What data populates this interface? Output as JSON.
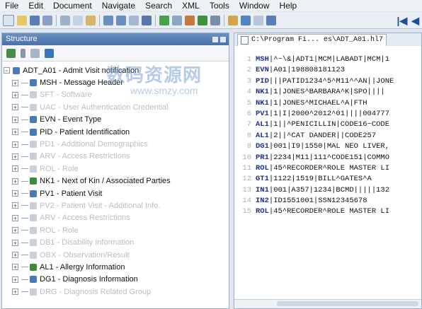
{
  "menu": [
    "File",
    "Edit",
    "Document",
    "Navigate",
    "Search",
    "XML",
    "Tools",
    "Window",
    "Help"
  ],
  "structure": {
    "title": "Structure",
    "rows": [
      {
        "code": "ADT_A01",
        "label": "ADT_A01 - Admit Visit notification",
        "dim": false,
        "root": true
      },
      {
        "code": "MSH",
        "label": "MSH - Message Header",
        "dim": false
      },
      {
        "code": "SFT",
        "label": "SFT - Software",
        "dim": true
      },
      {
        "code": "UAC",
        "label": "UAC - User Authentication Credential",
        "dim": true
      },
      {
        "code": "EVN",
        "label": "EVN - Event Type",
        "dim": false
      },
      {
        "code": "PID",
        "label": "PID - Patient Identification",
        "dim": false
      },
      {
        "code": "PD1",
        "label": "PD1 - Additional Demographics",
        "dim": true
      },
      {
        "code": "ARV",
        "label": "ARV - Access Restrictions",
        "dim": true
      },
      {
        "code": "ROL",
        "label": "ROL - Role",
        "dim": true
      },
      {
        "code": "NK1",
        "label": "NK1 - Next of Kin / Associated Parties",
        "dim": false,
        "group": true
      },
      {
        "code": "PV1",
        "label": "PV1 - Patient Visit",
        "dim": false
      },
      {
        "code": "PV2",
        "label": "PV2 - Patient Visit - Additional Info.",
        "dim": true
      },
      {
        "code": "ARV",
        "label": "ARV - Access Restrictions",
        "dim": true
      },
      {
        "code": "ROL",
        "label": "ROL - Role",
        "dim": true
      },
      {
        "code": "DB1",
        "label": "DB1 - Disability Information",
        "dim": true
      },
      {
        "code": "OBX",
        "label": "OBX - Observation/Result",
        "dim": true
      },
      {
        "code": "AL1",
        "label": "AL1 - Allergy Information",
        "dim": false,
        "group": true
      },
      {
        "code": "DG1",
        "label": "DG1 - Diagnosis Information",
        "dim": false
      },
      {
        "code": "DRG",
        "label": "DRG - Diagnosis Related Group",
        "dim": true
      }
    ]
  },
  "editor": {
    "tab": "C:\\Program Fi... es\\ADT_A01.hl7",
    "lines": [
      {
        "n": "1",
        "seg": "MSH",
        "rest": "|^~\\&|ADT1|MCM|LABADT|MCM|1"
      },
      {
        "n": "2",
        "seg": "EVN",
        "rest": "|A01|198808181123"
      },
      {
        "n": "3",
        "seg": "PID",
        "rest": "|||PATID1234^5^M11^^AN||JONE"
      },
      {
        "n": "4",
        "seg": "NK1",
        "rest": "|1|JONES^BARBARA^K|SPO||||"
      },
      {
        "n": "5",
        "seg": "NK1",
        "rest": "|1|JONES^MICHAEL^A|FTH"
      },
      {
        "n": "6",
        "seg": "PV1",
        "rest": "|1|I|2000^2012^01||||004777"
      },
      {
        "n": "7",
        "seg": "AL1",
        "rest": "|1||^PENICILLIN|CODE16~CODE"
      },
      {
        "n": "8",
        "seg": "AL1",
        "rest": "|2||^CAT DANDER||CODE257"
      },
      {
        "n": "9",
        "seg": "DG1",
        "rest": "|001|I9|1550|MAL NEO LIVER,"
      },
      {
        "n": "10",
        "seg": "PR1",
        "rest": "|2234|M11|111^CODE151|COMMO"
      },
      {
        "n": "11",
        "seg": "ROL",
        "rest": "|45^RECORDER^ROLE MASTER LI"
      },
      {
        "n": "12",
        "seg": "GT1",
        "rest": "|1122|1519|BILL^GATES^A"
      },
      {
        "n": "13",
        "seg": "IN1",
        "rest": "|001|A357|1234|BCMD|||||132"
      },
      {
        "n": "14",
        "seg": "IN2",
        "rest": "|ID1551001|SSN12345678"
      },
      {
        "n": "15",
        "seg": "ROL",
        "rest": "|45^RECORDER^ROLE MASTER LI"
      }
    ]
  },
  "watermark": {
    "line1": "数码资源网",
    "line2": "www.smzy.com"
  }
}
